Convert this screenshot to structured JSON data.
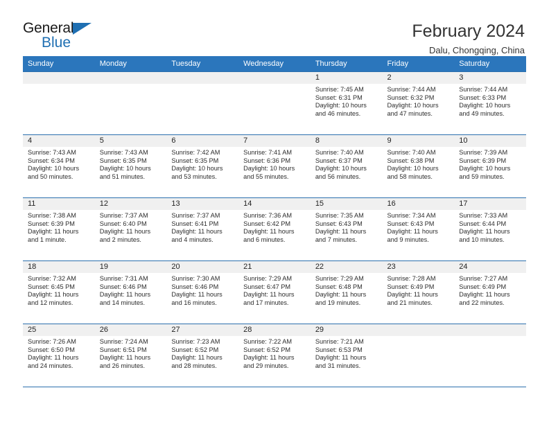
{
  "brand": {
    "name_part1": "General",
    "name_part2": "Blue",
    "accent_color": "#1f6fb2"
  },
  "header": {
    "title": "February 2024",
    "subtitle": "Dalu, Chongqing, China"
  },
  "theme": {
    "header_bg": "#2b76bc",
    "row_divider": "#2b6fad",
    "daynum_bg": "#f0f0f0"
  },
  "weekday_headers": [
    "Sunday",
    "Monday",
    "Tuesday",
    "Wednesday",
    "Thursday",
    "Friday",
    "Saturday"
  ],
  "weeks": [
    [
      {
        "day": "",
        "sunrise": "",
        "sunset": "",
        "daylight1": "",
        "daylight2": "",
        "empty": true
      },
      {
        "day": "",
        "sunrise": "",
        "sunset": "",
        "daylight1": "",
        "daylight2": "",
        "empty": true
      },
      {
        "day": "",
        "sunrise": "",
        "sunset": "",
        "daylight1": "",
        "daylight2": "",
        "empty": true
      },
      {
        "day": "",
        "sunrise": "",
        "sunset": "",
        "daylight1": "",
        "daylight2": "",
        "empty": true
      },
      {
        "day": "1",
        "sunrise": "Sunrise: 7:45 AM",
        "sunset": "Sunset: 6:31 PM",
        "daylight1": "Daylight: 10 hours",
        "daylight2": "and 46 minutes.",
        "empty": false
      },
      {
        "day": "2",
        "sunrise": "Sunrise: 7:44 AM",
        "sunset": "Sunset: 6:32 PM",
        "daylight1": "Daylight: 10 hours",
        "daylight2": "and 47 minutes.",
        "empty": false
      },
      {
        "day": "3",
        "sunrise": "Sunrise: 7:44 AM",
        "sunset": "Sunset: 6:33 PM",
        "daylight1": "Daylight: 10 hours",
        "daylight2": "and 49 minutes.",
        "empty": false
      }
    ],
    [
      {
        "day": "4",
        "sunrise": "Sunrise: 7:43 AM",
        "sunset": "Sunset: 6:34 PM",
        "daylight1": "Daylight: 10 hours",
        "daylight2": "and 50 minutes.",
        "empty": false
      },
      {
        "day": "5",
        "sunrise": "Sunrise: 7:43 AM",
        "sunset": "Sunset: 6:35 PM",
        "daylight1": "Daylight: 10 hours",
        "daylight2": "and 51 minutes.",
        "empty": false
      },
      {
        "day": "6",
        "sunrise": "Sunrise: 7:42 AM",
        "sunset": "Sunset: 6:35 PM",
        "daylight1": "Daylight: 10 hours",
        "daylight2": "and 53 minutes.",
        "empty": false
      },
      {
        "day": "7",
        "sunrise": "Sunrise: 7:41 AM",
        "sunset": "Sunset: 6:36 PM",
        "daylight1": "Daylight: 10 hours",
        "daylight2": "and 55 minutes.",
        "empty": false
      },
      {
        "day": "8",
        "sunrise": "Sunrise: 7:40 AM",
        "sunset": "Sunset: 6:37 PM",
        "daylight1": "Daylight: 10 hours",
        "daylight2": "and 56 minutes.",
        "empty": false
      },
      {
        "day": "9",
        "sunrise": "Sunrise: 7:40 AM",
        "sunset": "Sunset: 6:38 PM",
        "daylight1": "Daylight: 10 hours",
        "daylight2": "and 58 minutes.",
        "empty": false
      },
      {
        "day": "10",
        "sunrise": "Sunrise: 7:39 AM",
        "sunset": "Sunset: 6:39 PM",
        "daylight1": "Daylight: 10 hours",
        "daylight2": "and 59 minutes.",
        "empty": false
      }
    ],
    [
      {
        "day": "11",
        "sunrise": "Sunrise: 7:38 AM",
        "sunset": "Sunset: 6:39 PM",
        "daylight1": "Daylight: 11 hours",
        "daylight2": "and 1 minute.",
        "empty": false
      },
      {
        "day": "12",
        "sunrise": "Sunrise: 7:37 AM",
        "sunset": "Sunset: 6:40 PM",
        "daylight1": "Daylight: 11 hours",
        "daylight2": "and 2 minutes.",
        "empty": false
      },
      {
        "day": "13",
        "sunrise": "Sunrise: 7:37 AM",
        "sunset": "Sunset: 6:41 PM",
        "daylight1": "Daylight: 11 hours",
        "daylight2": "and 4 minutes.",
        "empty": false
      },
      {
        "day": "14",
        "sunrise": "Sunrise: 7:36 AM",
        "sunset": "Sunset: 6:42 PM",
        "daylight1": "Daylight: 11 hours",
        "daylight2": "and 6 minutes.",
        "empty": false
      },
      {
        "day": "15",
        "sunrise": "Sunrise: 7:35 AM",
        "sunset": "Sunset: 6:43 PM",
        "daylight1": "Daylight: 11 hours",
        "daylight2": "and 7 minutes.",
        "empty": false
      },
      {
        "day": "16",
        "sunrise": "Sunrise: 7:34 AM",
        "sunset": "Sunset: 6:43 PM",
        "daylight1": "Daylight: 11 hours",
        "daylight2": "and 9 minutes.",
        "empty": false
      },
      {
        "day": "17",
        "sunrise": "Sunrise: 7:33 AM",
        "sunset": "Sunset: 6:44 PM",
        "daylight1": "Daylight: 11 hours",
        "daylight2": "and 10 minutes.",
        "empty": false
      }
    ],
    [
      {
        "day": "18",
        "sunrise": "Sunrise: 7:32 AM",
        "sunset": "Sunset: 6:45 PM",
        "daylight1": "Daylight: 11 hours",
        "daylight2": "and 12 minutes.",
        "empty": false
      },
      {
        "day": "19",
        "sunrise": "Sunrise: 7:31 AM",
        "sunset": "Sunset: 6:46 PM",
        "daylight1": "Daylight: 11 hours",
        "daylight2": "and 14 minutes.",
        "empty": false
      },
      {
        "day": "20",
        "sunrise": "Sunrise: 7:30 AM",
        "sunset": "Sunset: 6:46 PM",
        "daylight1": "Daylight: 11 hours",
        "daylight2": "and 16 minutes.",
        "empty": false
      },
      {
        "day": "21",
        "sunrise": "Sunrise: 7:29 AM",
        "sunset": "Sunset: 6:47 PM",
        "daylight1": "Daylight: 11 hours",
        "daylight2": "and 17 minutes.",
        "empty": false
      },
      {
        "day": "22",
        "sunrise": "Sunrise: 7:29 AM",
        "sunset": "Sunset: 6:48 PM",
        "daylight1": "Daylight: 11 hours",
        "daylight2": "and 19 minutes.",
        "empty": false
      },
      {
        "day": "23",
        "sunrise": "Sunrise: 7:28 AM",
        "sunset": "Sunset: 6:49 PM",
        "daylight1": "Daylight: 11 hours",
        "daylight2": "and 21 minutes.",
        "empty": false
      },
      {
        "day": "24",
        "sunrise": "Sunrise: 7:27 AM",
        "sunset": "Sunset: 6:49 PM",
        "daylight1": "Daylight: 11 hours",
        "daylight2": "and 22 minutes.",
        "empty": false
      }
    ],
    [
      {
        "day": "25",
        "sunrise": "Sunrise: 7:26 AM",
        "sunset": "Sunset: 6:50 PM",
        "daylight1": "Daylight: 11 hours",
        "daylight2": "and 24 minutes.",
        "empty": false
      },
      {
        "day": "26",
        "sunrise": "Sunrise: 7:24 AM",
        "sunset": "Sunset: 6:51 PM",
        "daylight1": "Daylight: 11 hours",
        "daylight2": "and 26 minutes.",
        "empty": false
      },
      {
        "day": "27",
        "sunrise": "Sunrise: 7:23 AM",
        "sunset": "Sunset: 6:52 PM",
        "daylight1": "Daylight: 11 hours",
        "daylight2": "and 28 minutes.",
        "empty": false
      },
      {
        "day": "28",
        "sunrise": "Sunrise: 7:22 AM",
        "sunset": "Sunset: 6:52 PM",
        "daylight1": "Daylight: 11 hours",
        "daylight2": "and 29 minutes.",
        "empty": false
      },
      {
        "day": "29",
        "sunrise": "Sunrise: 7:21 AM",
        "sunset": "Sunset: 6:53 PM",
        "daylight1": "Daylight: 11 hours",
        "daylight2": "and 31 minutes.",
        "empty": false
      },
      {
        "day": "",
        "sunrise": "",
        "sunset": "",
        "daylight1": "",
        "daylight2": "",
        "empty": true
      },
      {
        "day": "",
        "sunrise": "",
        "sunset": "",
        "daylight1": "",
        "daylight2": "",
        "empty": true
      }
    ]
  ]
}
